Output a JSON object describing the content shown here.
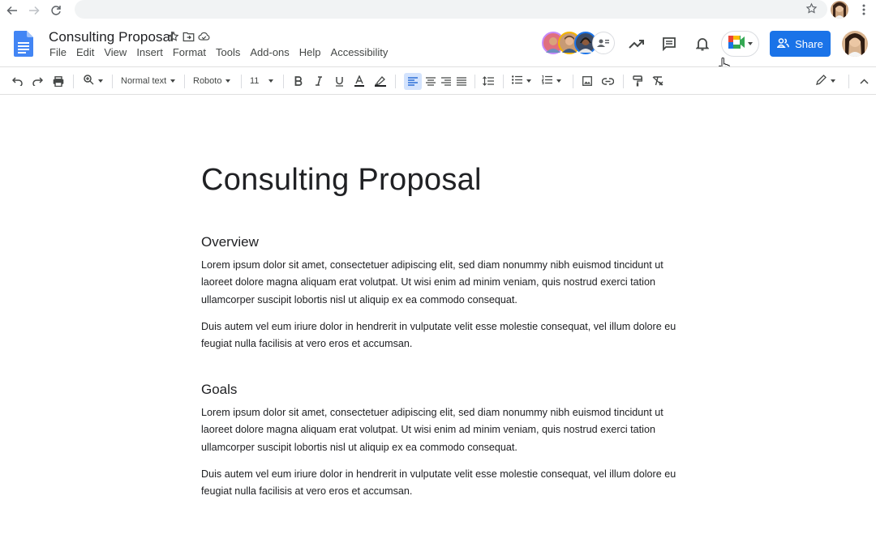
{
  "document": {
    "title": "Consulting Proposal",
    "heading": "Consulting Proposal",
    "sections": [
      {
        "heading": "Overview",
        "paragraphs": [
          "Lorem ipsum dolor sit amet, consectetuer adipiscing elit, sed diam nonummy nibh euismod tincidunt ut laoreet dolore magna aliquam erat volutpat. Ut wisi enim ad minim veniam, quis nostrud exerci tation ullamcorper suscipit lobortis nisl ut aliquip ex ea commodo consequat.",
          "Duis autem vel eum iriure dolor in hendrerit in vulputate velit esse molestie consequat, vel illum dolore eu feugiat nulla facilisis at vero eros et accumsan."
        ]
      },
      {
        "heading": "Goals",
        "paragraphs": [
          "Lorem ipsum dolor sit amet, consectetuer adipiscing elit, sed diam nonummy nibh euismod tincidunt ut laoreet dolore magna aliquam erat volutpat. Ut wisi enim ad minim veniam, quis nostrud exerci tation ullamcorper suscipit lobortis nisl ut aliquip ex ea commodo consequat.",
          "Duis autem vel eum iriure dolor in hendrerit in vulputate velit esse molestie consequat, vel illum dolore eu feugiat nulla facilisis at vero eros et accumsan."
        ]
      }
    ]
  },
  "menu": [
    "File",
    "Edit",
    "View",
    "Insert",
    "Format",
    "Tools",
    "Add-ons",
    "Help",
    "Accessibility"
  ],
  "header": {
    "share_label": "Share"
  },
  "toolbar": {
    "style": "Normal text",
    "font": "Roboto",
    "size": "11"
  },
  "colors": {
    "brand_blue": "#1a73e8",
    "docs_blue": "#4285f4",
    "active_tool": "#d3e3fd"
  },
  "icons": [
    "back-icon",
    "forward-icon",
    "reload-icon",
    "bookmark-star-icon",
    "browser-menu-icon",
    "docs-logo-icon",
    "star-icon",
    "move-folder-icon",
    "cloud-saved-icon",
    "activity-trend-icon",
    "comments-icon",
    "notifications-bell-icon",
    "meet-icon",
    "share-people-icon",
    "undo-icon",
    "redo-icon",
    "print-icon",
    "zoom-icon",
    "bold-icon",
    "italic-icon",
    "underline-icon",
    "text-color-icon",
    "highlight-icon",
    "align-left-icon",
    "align-center-icon",
    "align-right-icon",
    "justify-icon",
    "line-spacing-icon",
    "bulleted-list-icon",
    "numbered-list-icon",
    "insert-image-icon",
    "insert-link-icon",
    "paint-format-icon",
    "clear-formatting-icon",
    "editing-mode-icon",
    "collapse-icon"
  ]
}
